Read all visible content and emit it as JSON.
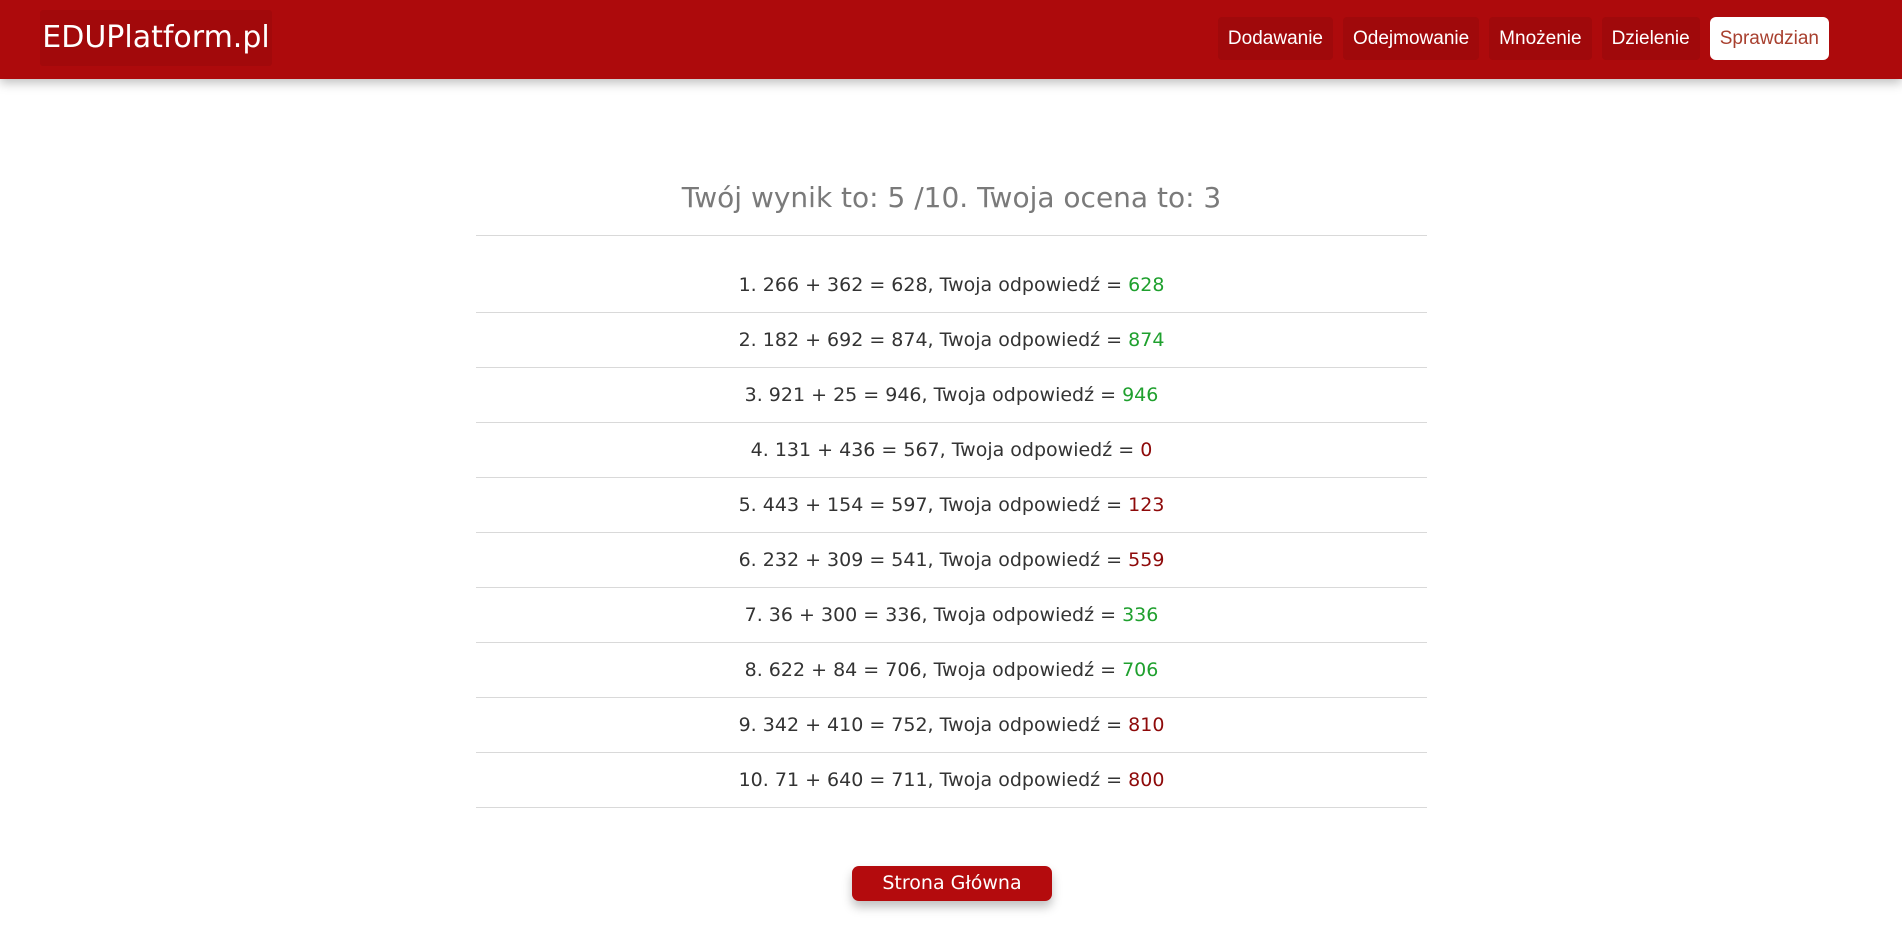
{
  "brand": "EDUPlatform.pl",
  "nav": {
    "items": [
      {
        "label": "Dodawanie",
        "active": false
      },
      {
        "label": "Odejmowanie",
        "active": false
      },
      {
        "label": "Mnożenie",
        "active": false
      },
      {
        "label": "Dzielenie",
        "active": false
      },
      {
        "label": "Sprawdzian",
        "active": true
      }
    ]
  },
  "result": {
    "score_text": "Twój wynik to: 5 /10. Twoja ocena to: 3"
  },
  "questions": [
    {
      "text": "1. 266 + 362 = 628, Twoja odpowiedź = ",
      "answer": "628",
      "correct": true
    },
    {
      "text": "2. 182 + 692 = 874, Twoja odpowiedź = ",
      "answer": "874",
      "correct": true
    },
    {
      "text": "3. 921 + 25 = 946, Twoja odpowiedź = ",
      "answer": "946",
      "correct": true
    },
    {
      "text": "4. 131 + 436 = 567, Twoja odpowiedź = ",
      "answer": "0",
      "correct": false
    },
    {
      "text": "5. 443 + 154 = 597, Twoja odpowiedź = ",
      "answer": "123",
      "correct": false
    },
    {
      "text": "6. 232 + 309 = 541, Twoja odpowiedź = ",
      "answer": "559",
      "correct": false
    },
    {
      "text": "7. 36 + 300 = 336, Twoja odpowiedź = ",
      "answer": "336",
      "correct": true
    },
    {
      "text": "8. 622 + 84 = 706, Twoja odpowiedź = ",
      "answer": "706",
      "correct": true
    },
    {
      "text": "9. 342 + 410 = 752, Twoja odpowiedź = ",
      "answer": "810",
      "correct": false
    },
    {
      "text": "10. 71 + 640 = 711, Twoja odpowiedź = ",
      "answer": "800",
      "correct": false
    }
  ],
  "home_button": "Strona Główna",
  "colors": {
    "brand_red": "#ad0a0c",
    "correct": "#1fa02e",
    "incorrect": "#8e0a0a"
  }
}
